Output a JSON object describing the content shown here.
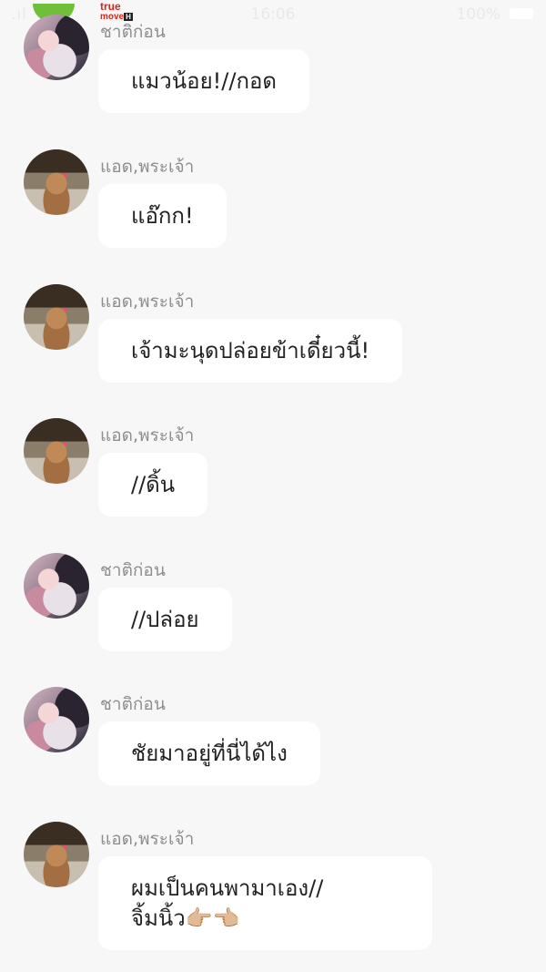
{
  "status_bar": {
    "signal": ".ıl",
    "carrier_top": "true",
    "carrier_bottom": "move",
    "carrier_badge": "H",
    "time": "16:06",
    "battery": "100%"
  },
  "messages": [
    {
      "sender": "ชาติก่อน",
      "avatar": "girl-avatar",
      "lines": [
        "แมวน้อย!//กอด"
      ]
    },
    {
      "sender": "แอด,พระเจ้า",
      "avatar": "cat-avatar",
      "lines": [
        "แอ๊กก!"
      ]
    },
    {
      "sender": "แอด,พระเจ้า",
      "avatar": "cat-avatar",
      "lines": [
        "เจ้ามะนุดปล่อยข้าเดี๋ยวนี้!"
      ]
    },
    {
      "sender": "แอด,พระเจ้า",
      "avatar": "cat-avatar",
      "lines": [
        "//ดิ้น"
      ]
    },
    {
      "sender": "ชาติก่อน",
      "avatar": "girl-avatar",
      "lines": [
        "//ปล่อย"
      ]
    },
    {
      "sender": "ชาติก่อน",
      "avatar": "girl-avatar",
      "lines": [
        "ชัยมาอยู่ที่นี่ได้ไง"
      ]
    },
    {
      "sender": "แอด,พระเจ้า",
      "avatar": "cat-avatar",
      "lines": [
        "ผมเป็นคนพามาเอง//",
        "จิ้มนิ้ว👉🏼👈🏼"
      ]
    }
  ]
}
